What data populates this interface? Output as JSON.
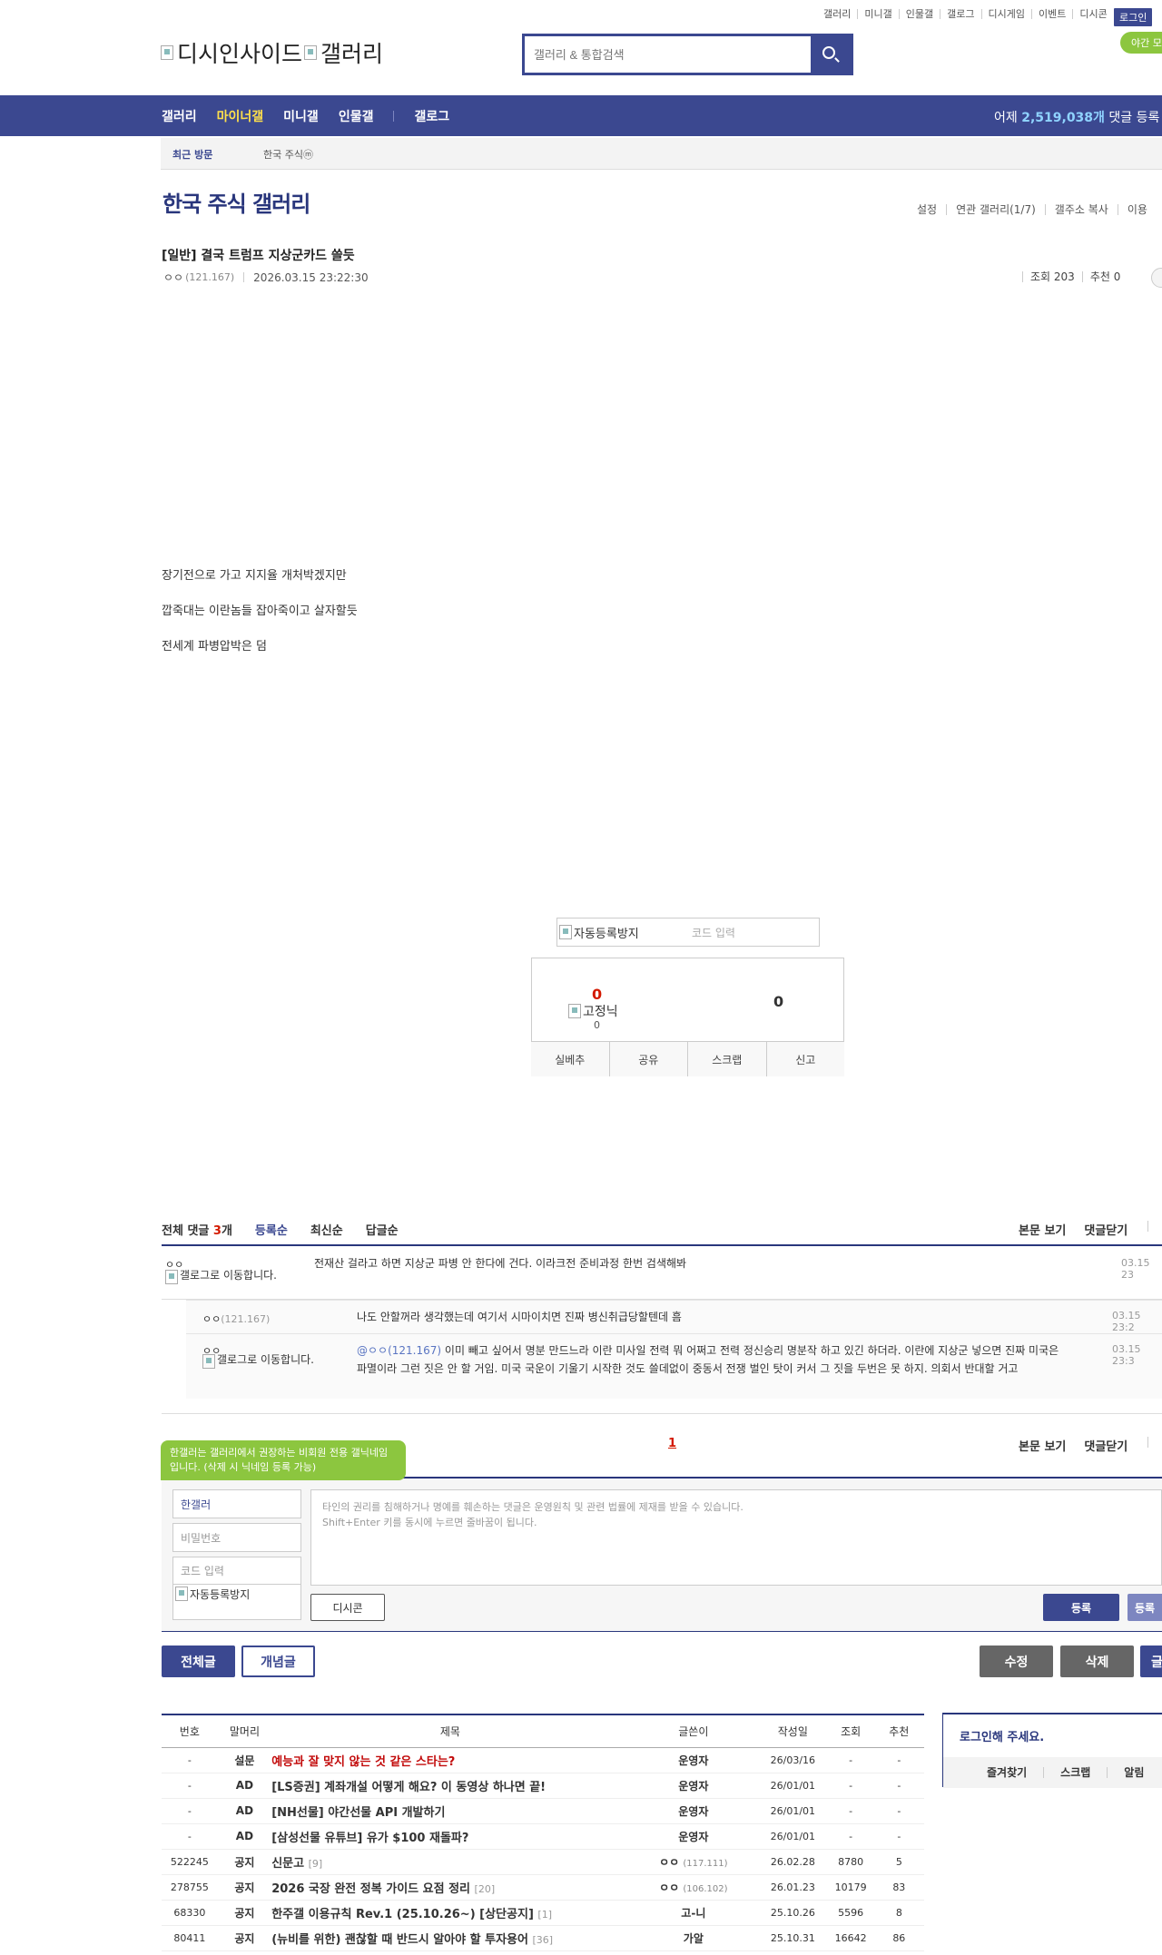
{
  "top_links": [
    "갤러리",
    "미니갤",
    "인물갤",
    "갤로그",
    "디시게임",
    "이벤트",
    "디시콘"
  ],
  "login_label": "로그인",
  "night_mode_label": "야간 모",
  "logo": {
    "site_alt": "디시인사이드",
    "gallery_alt": "갤러리"
  },
  "search": {
    "placeholder": "갤러리 & 통합검색"
  },
  "nav": {
    "items": [
      {
        "label": "갤러리",
        "active": false
      },
      {
        "label": "마이너갤",
        "active": true
      },
      {
        "label": "미니갤",
        "active": false
      },
      {
        "label": "인물갤",
        "active": false
      }
    ],
    "gallog": "갤로그"
  },
  "yesterday": {
    "prefix": "어제",
    "count": "2,519,038개",
    "suffix": "댓글 등록"
  },
  "recent": {
    "label": "최근 방문",
    "item": "한국 주식ⓜ"
  },
  "gallery": {
    "title": "한국 주식 갤러리",
    "tools": [
      "설정",
      "연관 갤러리(1/7)",
      "갤주소 복사",
      "이용"
    ]
  },
  "post": {
    "title": "[일반] 결국 트럼프 지상군카드 쓸듯",
    "author": "ㅇㅇ",
    "ip": "(121.167)",
    "date": "2026.03.15 23:22:30",
    "views": "조회 203",
    "recommend": "추천 0",
    "body": [
      "장기전으로 가고 지지율 개처박겠지만",
      "깝죽대는 이란놈들 잡아죽이고 살자할듯",
      "전세계 파병압박은 덤"
    ]
  },
  "captcha": {
    "img_alt": "자동등록방지",
    "code_placeholder": "코드 입력"
  },
  "recommend_box": {
    "up_count": "0",
    "fixed_alt": "고정닉",
    "fixed_count": "0",
    "down_count": "0",
    "buttons": [
      "실베추",
      "공유",
      "스크랩",
      "신고"
    ]
  },
  "comments": {
    "total_label": "전체 댓글",
    "total_count": "3",
    "total_unit": "개",
    "sort_tabs": [
      {
        "label": "등록순",
        "active": true
      },
      {
        "label": "최신순",
        "active": false
      },
      {
        "label": "답글순",
        "active": false
      }
    ],
    "view_post": "본문 보기",
    "close_comments": "댓글닫기",
    "gallog_move": "갤로그로 이동합니다.",
    "list": [
      {
        "author": "ㅇㅇ",
        "text": "전재산 걸라고 하면 지상군 파병 안 한다에 건다. 이라크전 준비과정 한번 검색해봐",
        "date": "03.15 23"
      },
      {
        "author": "ㅇㅇ",
        "ip": "(121.167)",
        "text": "나도 안할꺼라 생각했는데 여기서 시마이치면 진짜 병신취급당할텐데 흠",
        "date": "03.15 23:2"
      },
      {
        "author": "ㅇㅇ",
        "mention": "@ㅇㅇ(121.167)",
        "text": "이미 빼고 싶어서 명분 만드느라 이란 미사일 전력 뭐 어쩌고 전력 정신승리 명분작 하고 있긴 하더라. 이란에 지상군 넣으면 진짜 미국은 파멸이라 그런 짓은 안 할 거임. 미국 국운이 기울기 시작한 것도 쓸데없이 중동서 전쟁 벌인 탓이 커서 그 짓을 두번은 못 하지. 의회서 반대할 거고",
        "date": "03.15 23:3"
      }
    ],
    "page": "1"
  },
  "write": {
    "tooltip": "한갤러는 갤러리에서 권장하는 비회원 전용 갤닉네임입니다. (삭제 시 닉네임 등록 가능)",
    "nickname": "한갤러",
    "password_placeholder": "비밀번호",
    "code_placeholder": "코드 입력",
    "captcha_alt": "자동등록방지",
    "textarea_line1": "타인의 권리를 침해하거나 명예를 훼손하는 댓글은 운영원칙 및 관련 법률에 제재를 받을 수 있습니다.",
    "textarea_line2": "Shift+Enter 키를 동시에 누르면 줄바꿈이 됩니다.",
    "dcon": "디시콘",
    "submit": "등록",
    "submit2": "등록"
  },
  "list_buttons": {
    "all": "전체글",
    "concept": "개념글",
    "edit": "수정",
    "delete": "삭제",
    "write": "글"
  },
  "post_list": {
    "headers": [
      "번호",
      "말머리",
      "제목",
      "글쓴이",
      "작성일",
      "조회",
      "추천"
    ],
    "rows": [
      {
        "no": "-",
        "head": "설문",
        "title": "예능과 잘 맞지 않는 것 같은 스타는?",
        "count": "",
        "writer": "운영자",
        "wip": "",
        "date": "26/03/16",
        "views": "-",
        "rec": "-",
        "survey": true
      },
      {
        "no": "-",
        "head": "AD",
        "title": "[LS증권] 계좌개설 어떻게 해요? 이 동영상 하나면 끝!",
        "count": "",
        "writer": "운영자",
        "wip": "",
        "date": "26/01/01",
        "views": "-",
        "rec": "-",
        "survey": false
      },
      {
        "no": "-",
        "head": "AD",
        "title": "[NH선물] 야간선물 API 개발하기",
        "count": "",
        "writer": "운영자",
        "wip": "",
        "date": "26/01/01",
        "views": "-",
        "rec": "-",
        "survey": false
      },
      {
        "no": "-",
        "head": "AD",
        "title": "[삼성선물 유튜브] 유가 $100 재돌파?",
        "count": "",
        "writer": "운영자",
        "wip": "",
        "date": "26/01/01",
        "views": "-",
        "rec": "-",
        "survey": false
      },
      {
        "no": "522245",
        "head": "공지",
        "title": "신문고",
        "count": "[9]",
        "writer": "ㅇㅇ",
        "wip": "(117.111)",
        "date": "26.02.28",
        "views": "8780",
        "rec": "5",
        "survey": false
      },
      {
        "no": "278755",
        "head": "공지",
        "title": "2026 국장 완전 정복 가이드 요점 정리",
        "count": "[20]",
        "writer": "ㅇㅇ",
        "wip": "(106.102)",
        "date": "26.01.23",
        "views": "10179",
        "rec": "83",
        "survey": false
      },
      {
        "no": "68330",
        "head": "공지",
        "title": "한주갤 이용규칙 Rev.1 (25.10.26~) [상단공지]",
        "count": "[1]",
        "writer": "고-니",
        "wip": "",
        "date": "25.10.26",
        "views": "5596",
        "rec": "8",
        "survey": false
      },
      {
        "no": "80411",
        "head": "공지",
        "title": "(뉴비를 위한) 괜찮할 때 반드시 알아야 할 투자용어",
        "count": "[36]",
        "writer": "가알",
        "wip": "",
        "date": "25.10.31",
        "views": "16642",
        "rec": "86",
        "survey": false
      }
    ]
  },
  "login_side": {
    "message": "로그인해 주세요.",
    "tools": [
      "즐겨찾기",
      "스크랩",
      "알림"
    ]
  }
}
